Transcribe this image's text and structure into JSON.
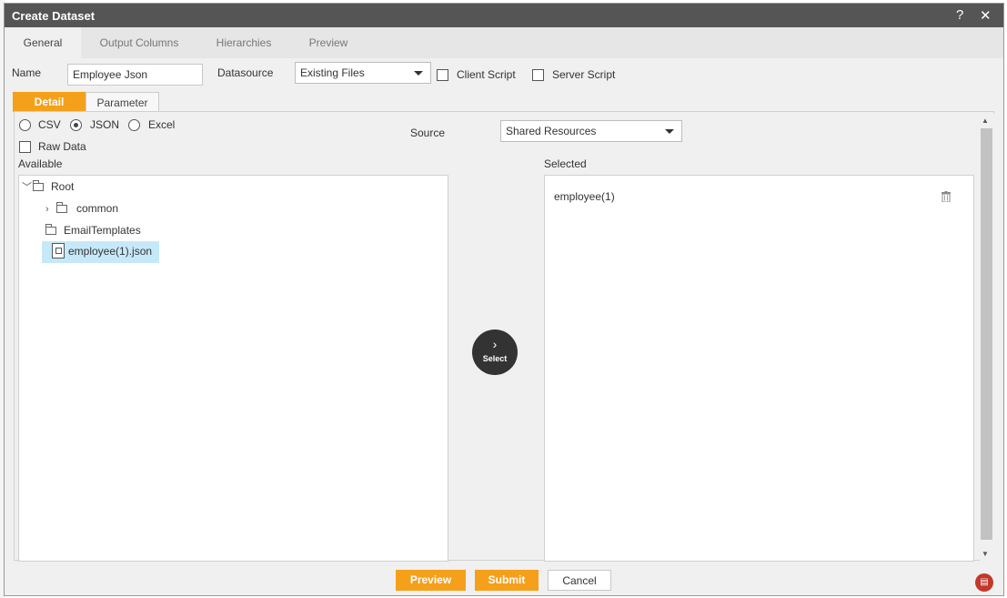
{
  "window": {
    "title": "Create Dataset",
    "help_icon": "help-icon",
    "close_icon": "close-icon"
  },
  "tabs": [
    {
      "label": "General",
      "active": true
    },
    {
      "label": "Output Columns",
      "active": false
    },
    {
      "label": "Hierarchies",
      "active": false
    },
    {
      "label": "Preview",
      "active": false
    }
  ],
  "form": {
    "name_label": "Name",
    "name_value": "Employee Json",
    "datasource_label": "Datasource",
    "datasource_value": "Existing Files",
    "client_script_label": "Client Script",
    "client_script_checked": false,
    "server_script_label": "Server Script",
    "server_script_checked": false
  },
  "subtabs": [
    {
      "label": "Detail",
      "active": true
    },
    {
      "label": "Parameter",
      "active": false
    }
  ],
  "detail": {
    "formats": [
      {
        "label": "CSV",
        "checked": false
      },
      {
        "label": "JSON",
        "checked": true
      },
      {
        "label": "Excel",
        "checked": false
      }
    ],
    "raw_data_label": "Raw Data",
    "raw_data_checked": false,
    "source_label": "Source",
    "source_value": "Shared Resources",
    "available_label": "Available",
    "selected_label": "Selected",
    "tree": {
      "root": "Root",
      "common": "common",
      "email_templates": "EmailTemplates",
      "file": "employee(1).json"
    },
    "selected_items": [
      "employee(1)"
    ],
    "select_button_label": "Select"
  },
  "footer": {
    "preview_label": "Preview",
    "submit_label": "Submit",
    "cancel_label": "Cancel"
  },
  "colors": {
    "accent": "#f5a01a",
    "titlebar": "#555556",
    "selection": "#c6e9f9"
  }
}
